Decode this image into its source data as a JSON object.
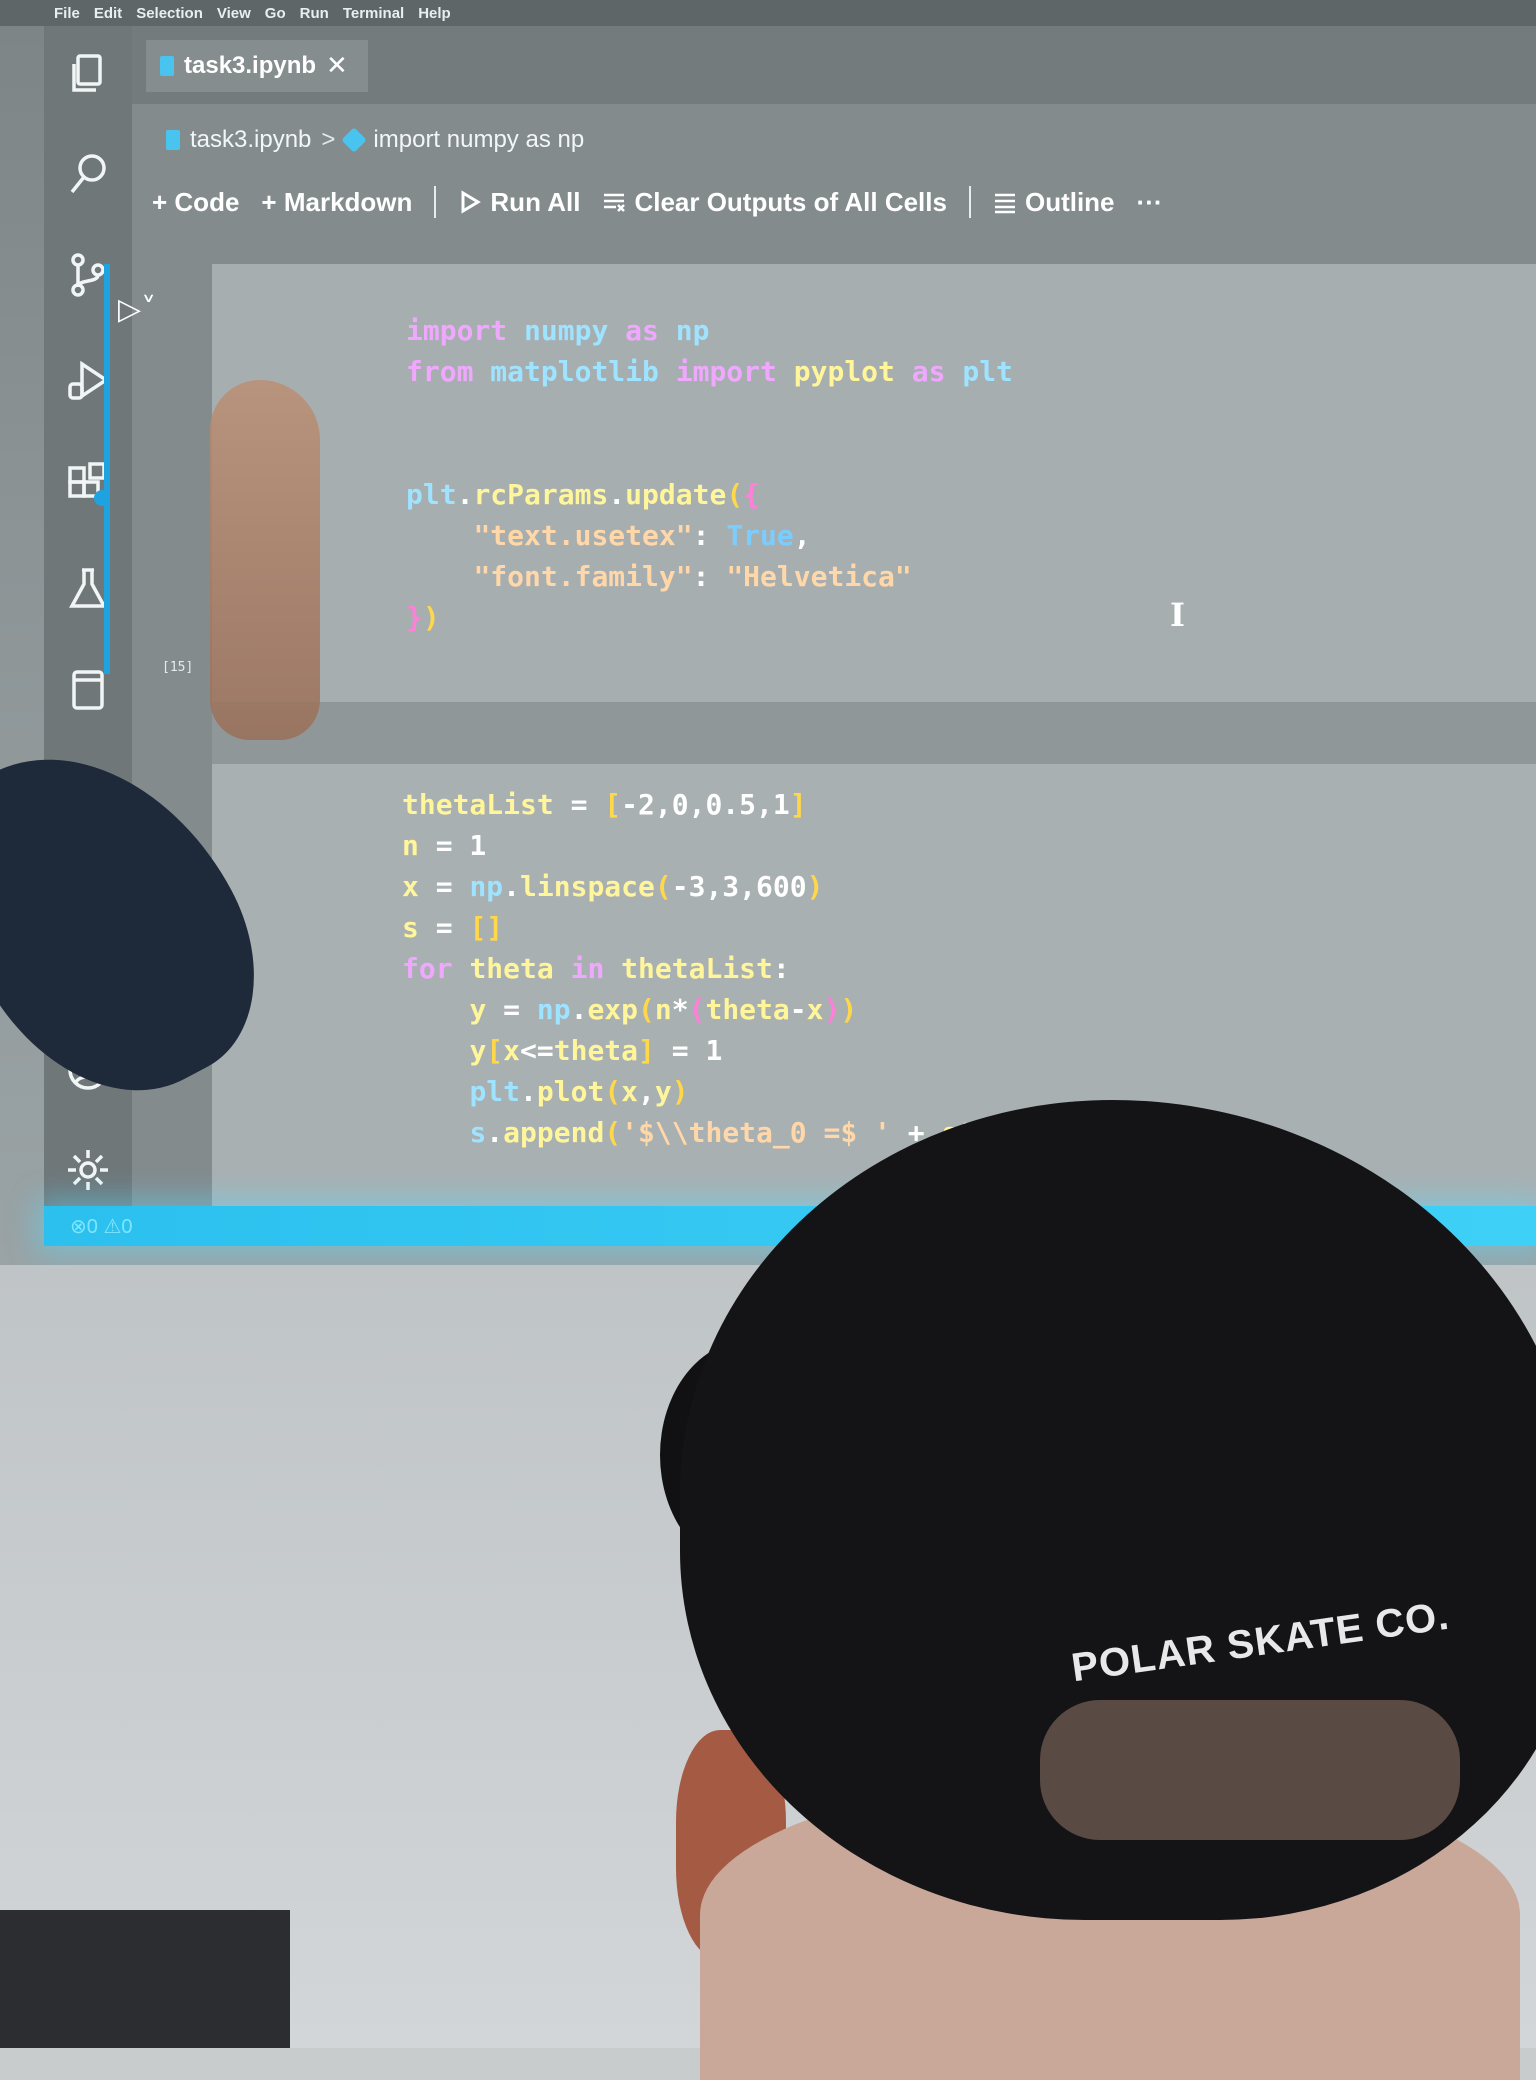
{
  "menubar": {
    "items": [
      "File",
      "Edit",
      "Selection",
      "View",
      "Go",
      "Run",
      "Terminal",
      "Help"
    ]
  },
  "tab": {
    "label": "task3.ipynb",
    "close": "✕"
  },
  "breadcrumb": {
    "file": "task3.ipynb",
    "separator": ">",
    "symbol": "import numpy as np"
  },
  "toolbar": {
    "code": "+ Code",
    "markdown": "+ Markdown",
    "run_all": "Run All",
    "clear_outputs": "Clear Outputs of All Cells",
    "outline": "Outline",
    "more": "···"
  },
  "cell1": {
    "lines": [
      "import numpy as np",
      "from matplotlib import pyplot as plt",
      "",
      "",
      "plt.rcParams.update({",
      "    \"text.usetex\": True,",
      "    \"font.family\": \"Helvetica\"",
      "})"
    ],
    "exec_count": "[15]"
  },
  "cell2": {
    "lines": [
      "thetaList = [-2,0,0.5,1]",
      "n = 1",
      "x = np.linspace(-3,3,600)",
      "s = []",
      "for theta in thetaList:",
      "    y = np.exp(n*(theta-x))",
      "    y[x<=theta] = 1",
      "    plt.plot(x,y)",
      "    s.append('$\\\\theta_0 =$ ' + str(theta))"
    ]
  },
  "statusbar": {
    "left": "⊗0 ⚠0"
  },
  "scene": {
    "cap_text": "POLAR SKATE CO."
  },
  "colors": {
    "accent": "#1ea3e0",
    "status": "#2bc0ee"
  }
}
